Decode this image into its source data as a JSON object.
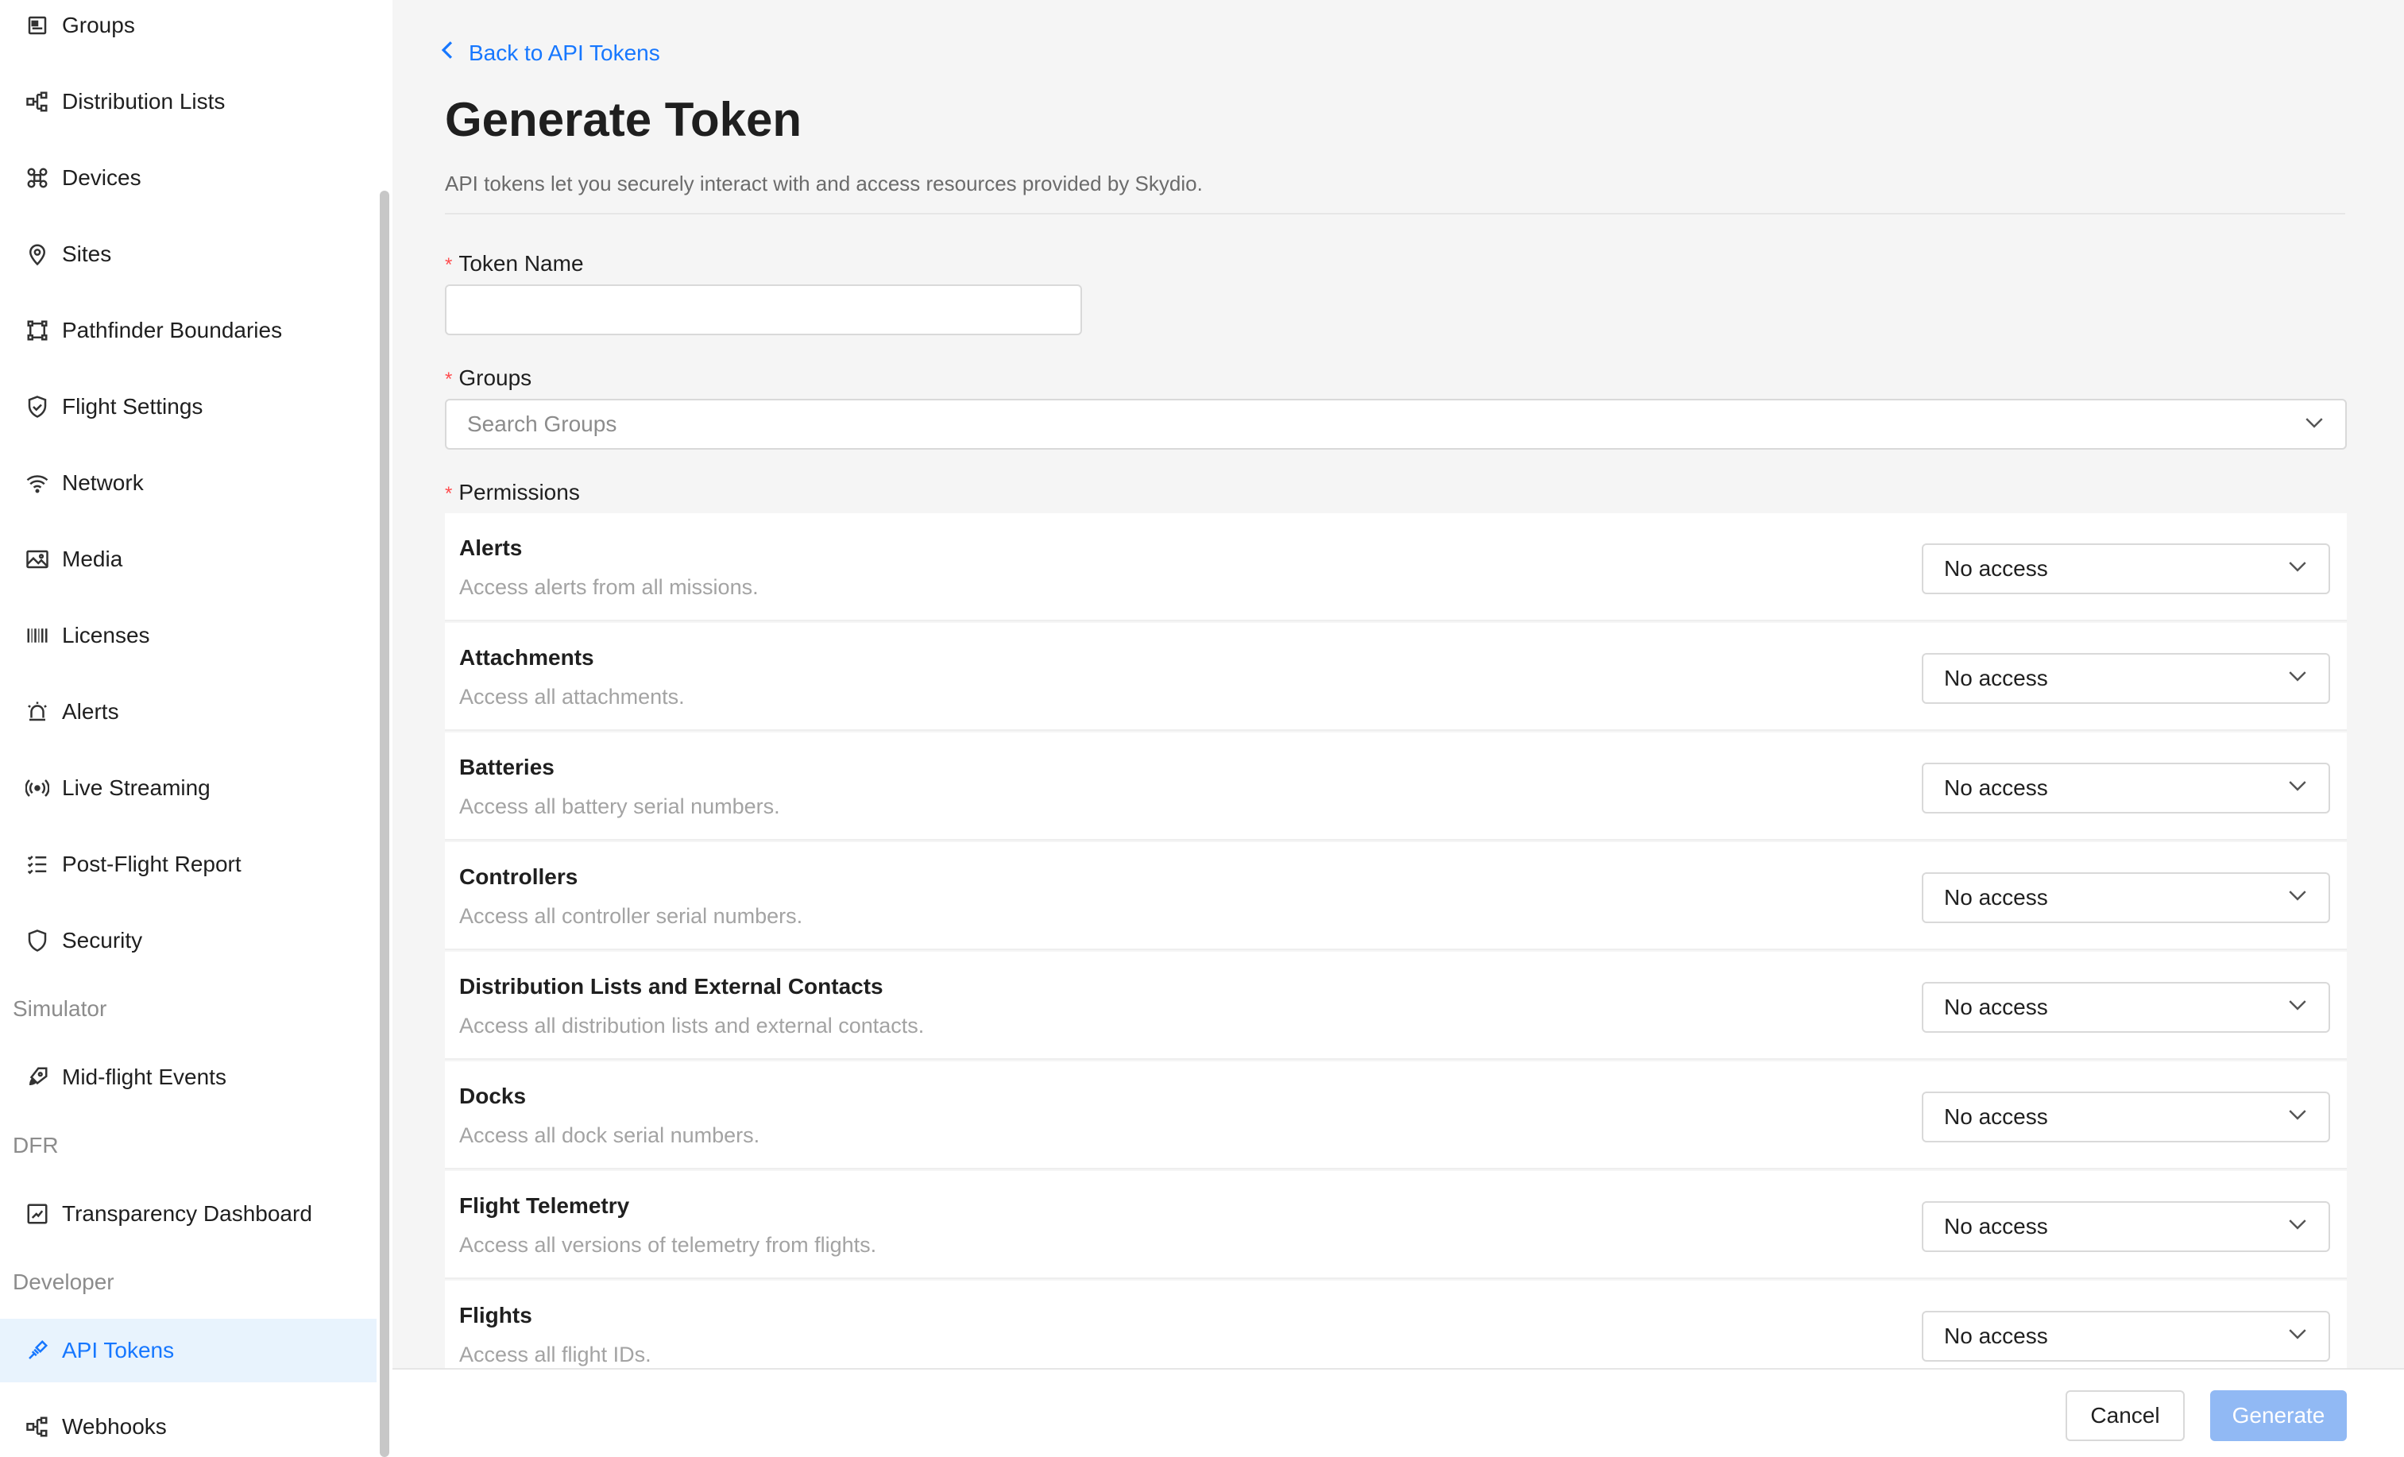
{
  "sidebar": {
    "items": [
      {
        "label": "Groups",
        "icon": "groups-icon"
      },
      {
        "label": "Distribution Lists",
        "icon": "distribution-lists-icon"
      },
      {
        "label": "Devices",
        "icon": "drone-icon"
      },
      {
        "label": "Sites",
        "icon": "location-pin-icon"
      },
      {
        "label": "Pathfinder Boundaries",
        "icon": "boundary-icon"
      },
      {
        "label": "Flight Settings",
        "icon": "shield-check-icon"
      },
      {
        "label": "Network",
        "icon": "wifi-icon"
      },
      {
        "label": "Media",
        "icon": "image-icon"
      },
      {
        "label": "Licenses",
        "icon": "barcode-icon"
      },
      {
        "label": "Alerts",
        "icon": "alarm-icon"
      },
      {
        "label": "Live Streaming",
        "icon": "broadcast-icon"
      },
      {
        "label": "Post-Flight Report",
        "icon": "checklist-icon"
      },
      {
        "label": "Security",
        "icon": "shield-icon"
      }
    ],
    "sections": {
      "simulator": "Simulator",
      "dfr": "DFR",
      "developer": "Developer"
    },
    "simulator_items": [
      {
        "label": "Mid-flight Events",
        "icon": "rocket-icon"
      }
    ],
    "dfr_items": [
      {
        "label": "Transparency Dashboard",
        "icon": "dashboard-icon"
      }
    ],
    "developer_items": [
      {
        "label": "API Tokens",
        "icon": "api-icon",
        "active": true
      },
      {
        "label": "Webhooks",
        "icon": "webhooks-icon"
      }
    ]
  },
  "main": {
    "back_label": "Back to API Tokens",
    "title": "Generate Token",
    "description": "API tokens let you securely interact with and access resources provided by Skydio.",
    "token_name_label": "Token Name",
    "token_name_value": "",
    "groups_label": "Groups",
    "groups_placeholder": "Search Groups",
    "permissions_label": "Permissions",
    "required_mark": "*",
    "permissions": [
      {
        "title": "Alerts",
        "desc": "Access alerts from all missions.",
        "value": "No access"
      },
      {
        "title": "Attachments",
        "desc": "Access all attachments.",
        "value": "No access"
      },
      {
        "title": "Batteries",
        "desc": "Access all battery serial numbers.",
        "value": "No access"
      },
      {
        "title": "Controllers",
        "desc": "Access all controller serial numbers.",
        "value": "No access"
      },
      {
        "title": "Distribution Lists and External Contacts",
        "desc": "Access all distribution lists and external contacts.",
        "value": "No access"
      },
      {
        "title": "Docks",
        "desc": "Access all dock serial numbers.",
        "value": "No access"
      },
      {
        "title": "Flight Telemetry",
        "desc": "Access all versions of telemetry from flights.",
        "value": "No access"
      },
      {
        "title": "Flights",
        "desc": "Access all flight IDs.",
        "value": "No access"
      }
    ]
  },
  "footer": {
    "cancel_label": "Cancel",
    "generate_label": "Generate"
  },
  "colors": {
    "accent": "#1677ff",
    "active_bg": "#e8f3fd",
    "required": "#ff4d4f",
    "generate_disabled": "#91b9f4"
  }
}
